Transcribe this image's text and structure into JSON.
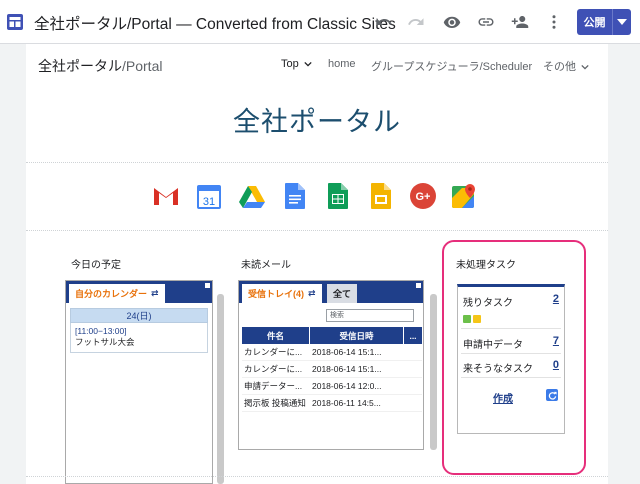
{
  "editor": {
    "title": "全社ポータル/Portal — Converted from Classic Sites",
    "publish_label": "公開",
    "toolbar_icons": [
      "undo-icon",
      "redo-icon",
      "preview-icon",
      "link-icon",
      "share-icon",
      "more-vert-icon"
    ]
  },
  "site": {
    "name_main": "全社ポータル",
    "name_sub": "/Portal",
    "nav": {
      "top": "Top",
      "home": "home",
      "scheduler": "グループスケジューラ/Scheduler",
      "more": "その他"
    },
    "page_title": "全社ポータル",
    "apps": [
      "gmail-icon",
      "calendar-icon",
      "drive-icon",
      "docs-icon",
      "sheets-icon",
      "slides-icon",
      "google-plus-icon",
      "maps-icon"
    ],
    "calendar_day": "31"
  },
  "sections": {
    "schedule": "今日の予定",
    "mail": "未読メール",
    "tasks": "未処理タスク"
  },
  "calendar_gadget": {
    "tab": "自分のカレンダー",
    "date": "24(日)",
    "event_time": "[11:00−13:00]",
    "event_title": "フットサル大会"
  },
  "mail_gadget": {
    "tab_inbox": "受信トレイ(4)",
    "tab_all": "全て",
    "search_placeholder": "検索",
    "columns": {
      "subject": "件名",
      "received": "受信日時",
      "more": "..."
    },
    "rows": [
      {
        "subject": "カレンダーに...",
        "received": "2018-06-14 15:1..."
      },
      {
        "subject": "カレンダーに...",
        "received": "2018-06-14 15:1..."
      },
      {
        "subject": "申請データー...",
        "received": "2018-06-14 12:0..."
      },
      {
        "subject": "掲示板 投稿通知",
        "received": "2018-06-11 14:5..."
      }
    ]
  },
  "task_gadget": {
    "remaining_label": "残りタスク",
    "remaining_count": "2",
    "pending_label": "申請中データ",
    "pending_count": "7",
    "overdue_label": "来そうなタスク",
    "overdue_count": "0",
    "create_label": "作成"
  },
  "colors": {
    "accent": "#3f51b5",
    "gadget_header": "#1f3f8a",
    "highlight": "#e62e7b",
    "title": "#1c4e6e"
  }
}
